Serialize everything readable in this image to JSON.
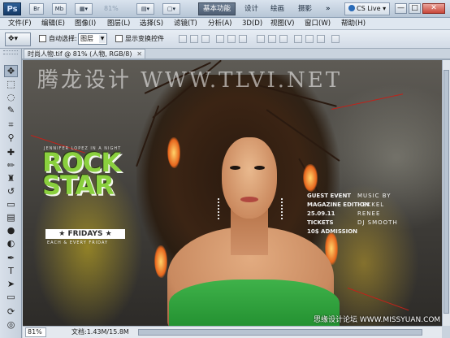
{
  "app": {
    "logo": "Ps",
    "chips": [
      "Br",
      "Mb"
    ],
    "zoom_select": "81%",
    "workspaces": [
      "基本功能",
      "设计",
      "绘画",
      "摄影"
    ],
    "more": "»",
    "cs_live": "CS Live",
    "window_controls": [
      "—",
      "□",
      "✕"
    ]
  },
  "menu": [
    "文件(F)",
    "编辑(E)",
    "图像(I)",
    "图层(L)",
    "选择(S)",
    "滤镜(T)",
    "分析(A)",
    "3D(D)",
    "视图(V)",
    "窗口(W)",
    "帮助(H)"
  ],
  "options": {
    "auto_select_label": "自动选择:",
    "auto_select_value": "图层",
    "show_transform_label": "显示变换控件"
  },
  "tools": [
    "move",
    "marquee",
    "lasso",
    "quick-select",
    "crop",
    "eyedropper",
    "healing",
    "brush",
    "clone-stamp",
    "history-brush",
    "eraser",
    "gradient",
    "blur",
    "dodge",
    "pen",
    "type",
    "path-select",
    "shape",
    "3d-rotate",
    "3d-orbit",
    "hand",
    "zoom"
  ],
  "document": {
    "tab_title": "时尚人物.tif @ 81% (人物, RGB/8)",
    "watermark": "腾龙设计 WWW.TLVI.NET",
    "poster": {
      "small_top": "JENNIFER LOPEZ IN A NIGHT",
      "title_line1": "ROCK",
      "title_line2": "STAR",
      "banner": "FRIDAYS",
      "banner_sub": "EACH & EVERY FRIDAY",
      "event_rows": [
        {
          "left": "GUEST EVENT",
          "right": "MUSIC BY"
        },
        {
          "left": "MAGAZINE EDITION",
          "right": "HEKKEL"
        },
        {
          "left": "25.09.11",
          "right": "RENEE"
        },
        {
          "left": "TICKETS",
          "right": "DJ SMOOTH"
        },
        {
          "left": "10$ ADMISSION",
          "right": ""
        }
      ]
    },
    "site_mark": "思缘设计论坛 WWW.MISSYUAN.COM"
  },
  "status": {
    "zoom": "81%",
    "doc_info": "文档:1.43M/15.8M"
  },
  "colors": {
    "accent": "#4f5f74",
    "dress": "#3fb24a",
    "rock_green": "#8ad03e"
  }
}
